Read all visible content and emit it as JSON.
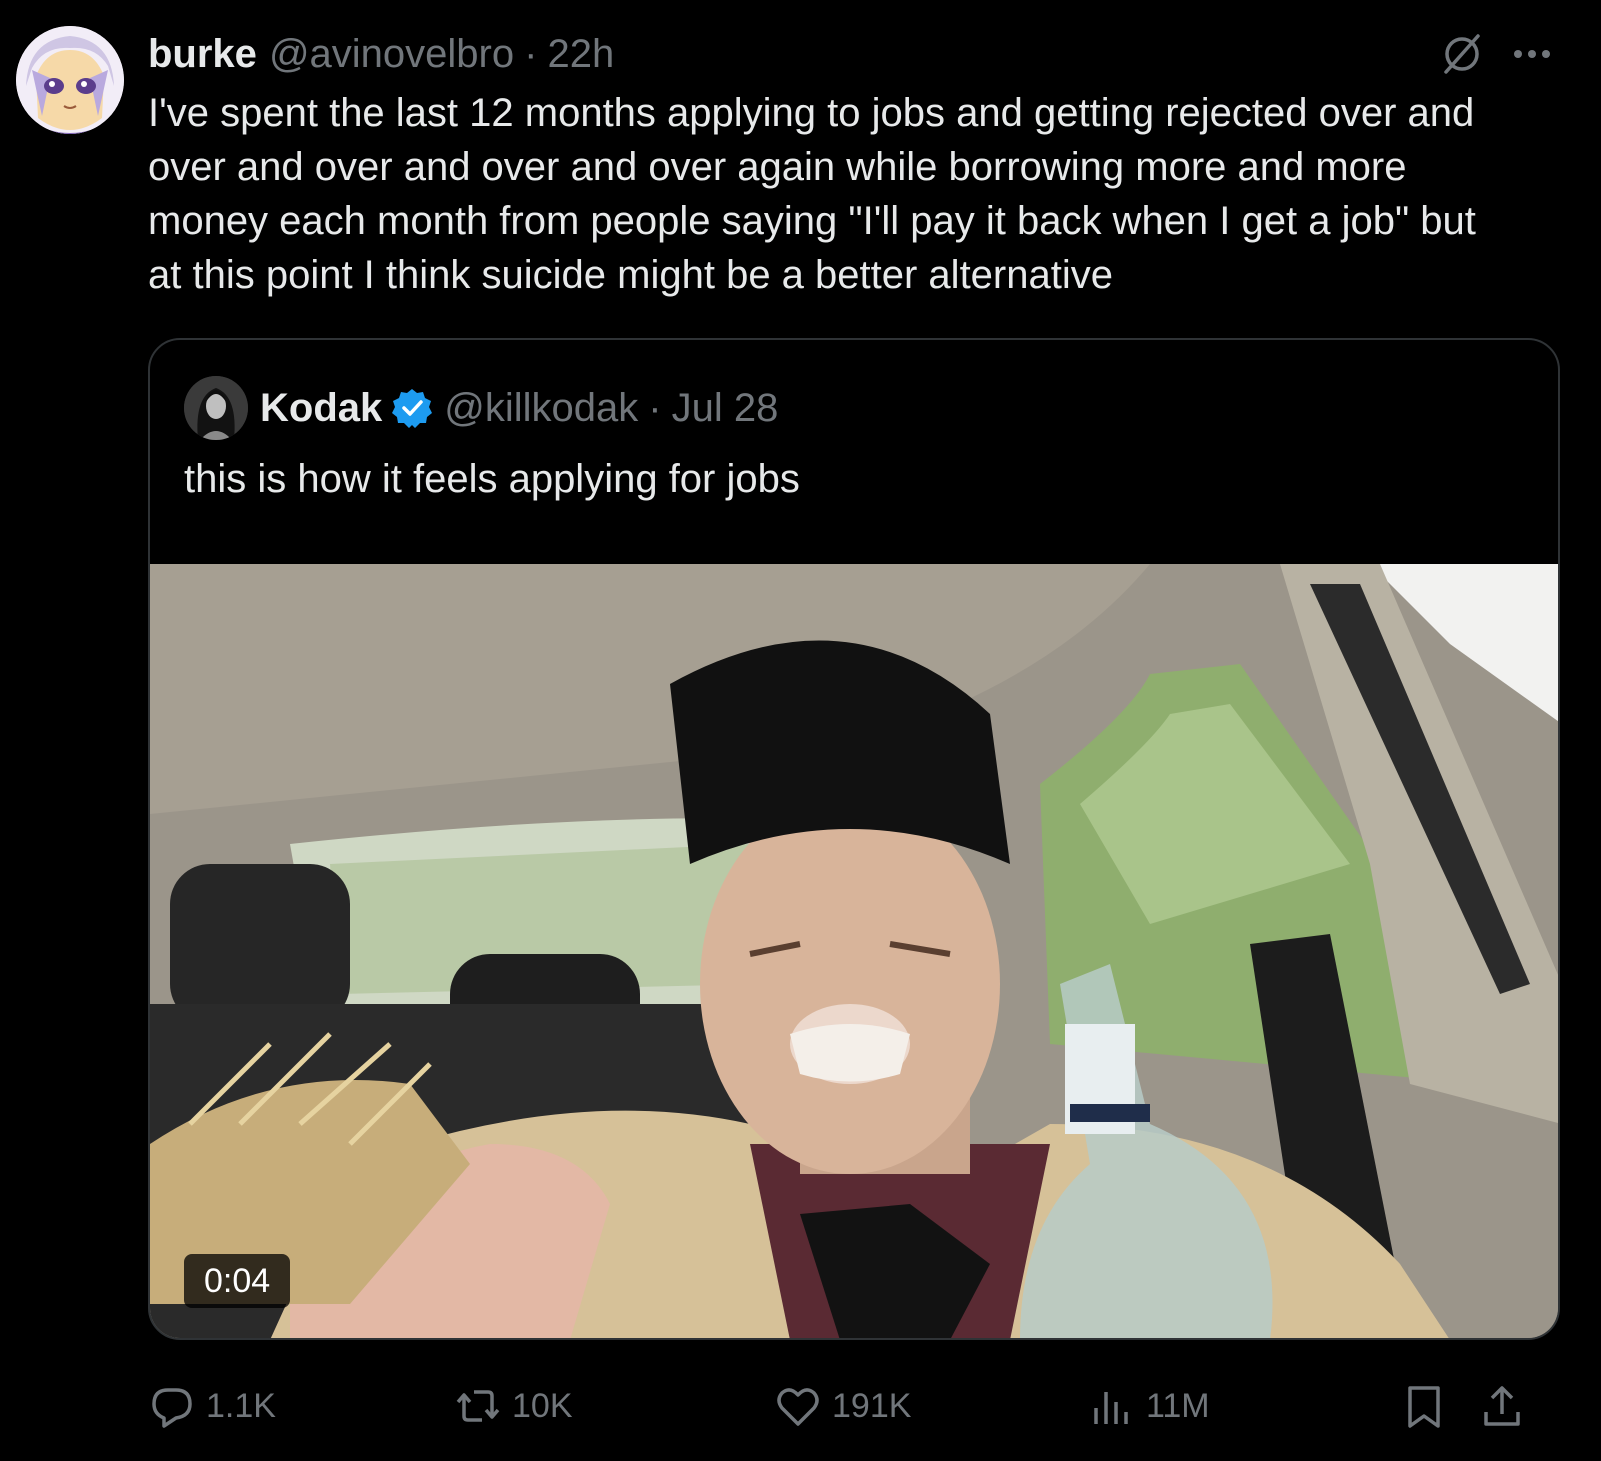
{
  "tweet": {
    "author_name": "burke",
    "handle": "@avinovelbro",
    "separator": "·",
    "time": "22h",
    "text_lines": [
      "I've spent the last 12 months applying to jobs and getting rejected over and",
      "over and over and over and over again while borrowing more and more",
      "money each month from people saying \"I'll pay it back when I get a job\" but",
      "at this point I think suicide might be a better alternative"
    ]
  },
  "quote": {
    "author_name": "Kodak",
    "handle": "@killkodak",
    "separator": "·",
    "time": "Jul 28",
    "text": "this is how it feels applying for jobs",
    "video_duration": "0:04",
    "verified_color": "#1d9bf0"
  },
  "actions": {
    "replies": "1.1K",
    "reposts": "10K",
    "likes": "191K",
    "views": "11M"
  },
  "icons": {
    "grok": "grok-icon",
    "more": "more-icon",
    "reply": "reply-icon",
    "repost": "repost-icon",
    "like": "heart-icon",
    "views": "views-icon",
    "bookmark": "bookmark-icon",
    "share": "share-icon",
    "verified": "verified-badge-icon"
  },
  "colors": {
    "background": "#000000",
    "text": "#e7e9ea",
    "secondary": "#71767b",
    "border": "#2f3336"
  }
}
